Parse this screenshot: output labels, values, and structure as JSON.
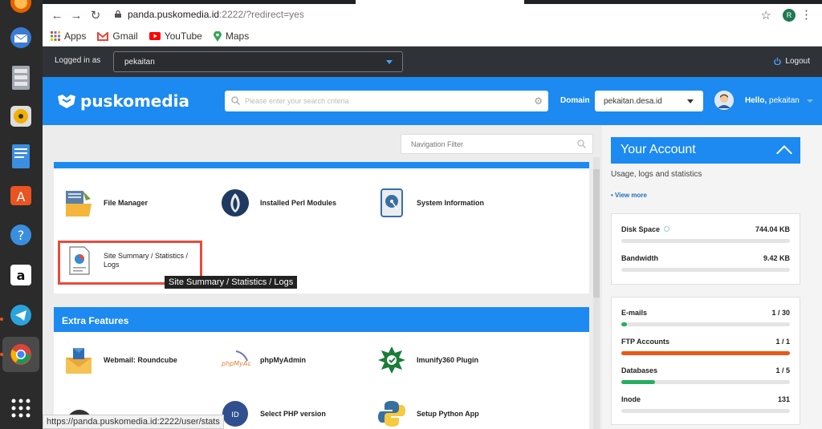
{
  "browser": {
    "url_host": "panda.puskomedia.id",
    "url_path": ":2222/?redirect=yes",
    "profile_initial": "R",
    "bookmarks": [
      "Apps",
      "Gmail",
      "YouTube",
      "Maps"
    ],
    "status_url": "https://panda.puskomedia.id:2222/user/stats"
  },
  "topbar": {
    "logged_in_label": "Logged in as",
    "user": "pekaitan",
    "logout": "Logout"
  },
  "header": {
    "logo": "puskomedia",
    "search_placeholder": "Please enter your search criteria",
    "domain_label": "Domain",
    "domain_value": "pekaitan.desa.id",
    "hello": "Hello,",
    "hello_user": "pekaitan"
  },
  "main": {
    "nav_filter_placeholder": "Navigation Filter",
    "top_features": [
      "File Manager",
      "Installed Perl Modules",
      "System Information",
      "Site Summary / Statistics / Logs"
    ],
    "tooltip": "Site Summary / Statistics / Logs",
    "extra_title": "Extra Features",
    "extra_features": [
      "Webmail: Roundcube",
      "phpMyAdmin",
      "Imunify360 Plugin",
      "Select PHP version",
      "Setup Python App"
    ]
  },
  "sidebar": {
    "title": "Your Account",
    "subtitle": "Usage, logs and statistics",
    "view_more": "• View more",
    "stats1": [
      {
        "label": "Disk Space",
        "value": "744.04 KB",
        "fraction": 0.0,
        "color": "#e4e4e4"
      },
      {
        "label": "Bandwidth",
        "value": "9.42 KB",
        "fraction": 0.0,
        "color": "#e4e4e4"
      }
    ],
    "stats2": [
      {
        "label": "E-mails",
        "value": "1 / 30",
        "fraction": 0.033,
        "color": "#27ae60"
      },
      {
        "label": "FTP Accounts",
        "value": "1 / 1",
        "fraction": 1.0,
        "color": "#e8591a"
      },
      {
        "label": "Databases",
        "value": "1 / 5",
        "fraction": 0.2,
        "color": "#27ae60"
      },
      {
        "label": "Inode",
        "value": "131",
        "fraction": 0.0,
        "color": "#e4e4e4"
      }
    ]
  },
  "colors": {
    "accent": "#1c8af0",
    "topbar": "#2f3237",
    "highlight": "#e74c3c"
  }
}
